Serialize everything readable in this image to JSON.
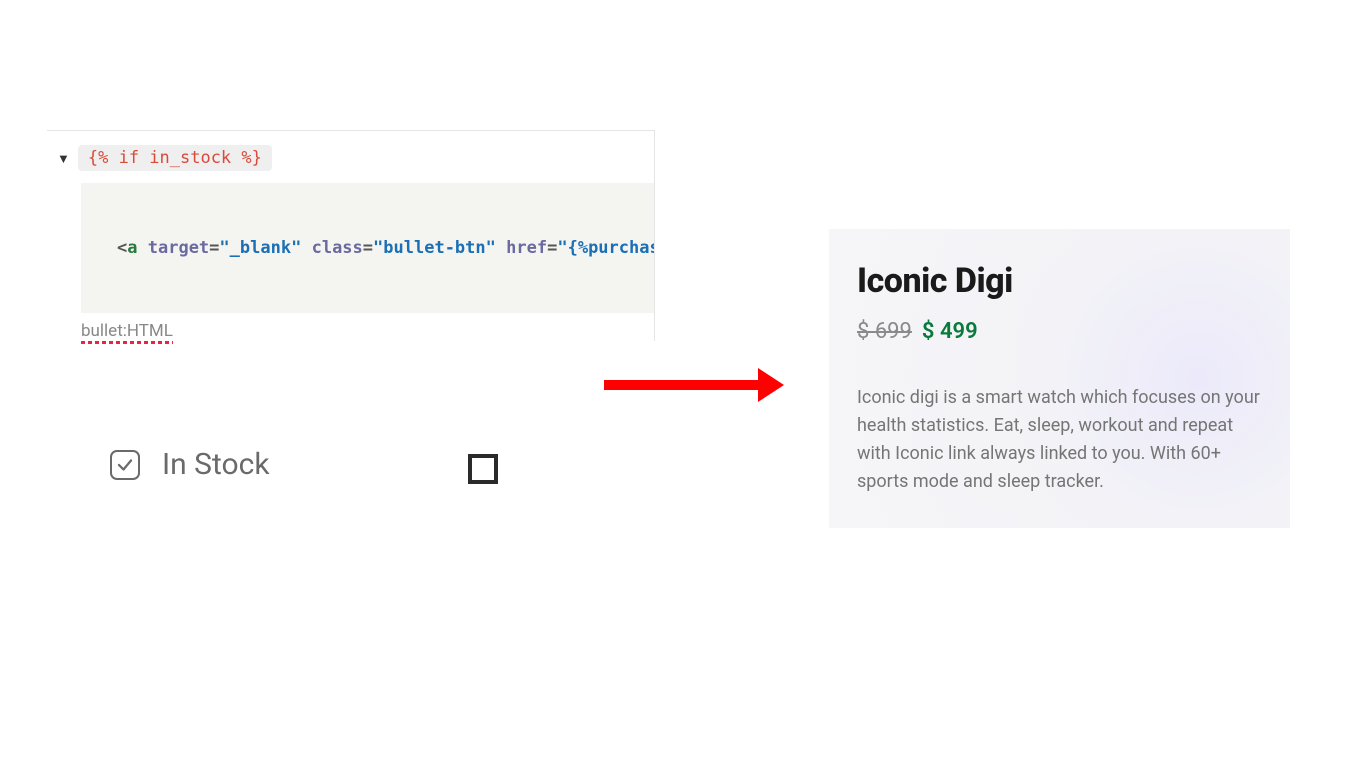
{
  "editor": {
    "tag_text": "{% if in_stock %}",
    "code_fragments": {
      "open_bracket": "<",
      "tag": "a",
      "sp": " ",
      "attr1": "target",
      "eq": "=",
      "q": "\"",
      "val1": "_blank",
      "attr2": "class",
      "val2": "bullet-btn",
      "attr3": "href",
      "val3_lead": "{%purchase"
    },
    "caption": "bullet:HTML"
  },
  "instock": {
    "label": "In Stock"
  },
  "product": {
    "title": "Iconic Digi",
    "old_price": "$ 699",
    "new_price": "$ 499",
    "description": "Iconic digi is a smart watch which focuses on your health statistics. Eat, sleep, workout and repeat with Iconic link always linked to you. With 60+ sports mode and sleep tracker."
  }
}
